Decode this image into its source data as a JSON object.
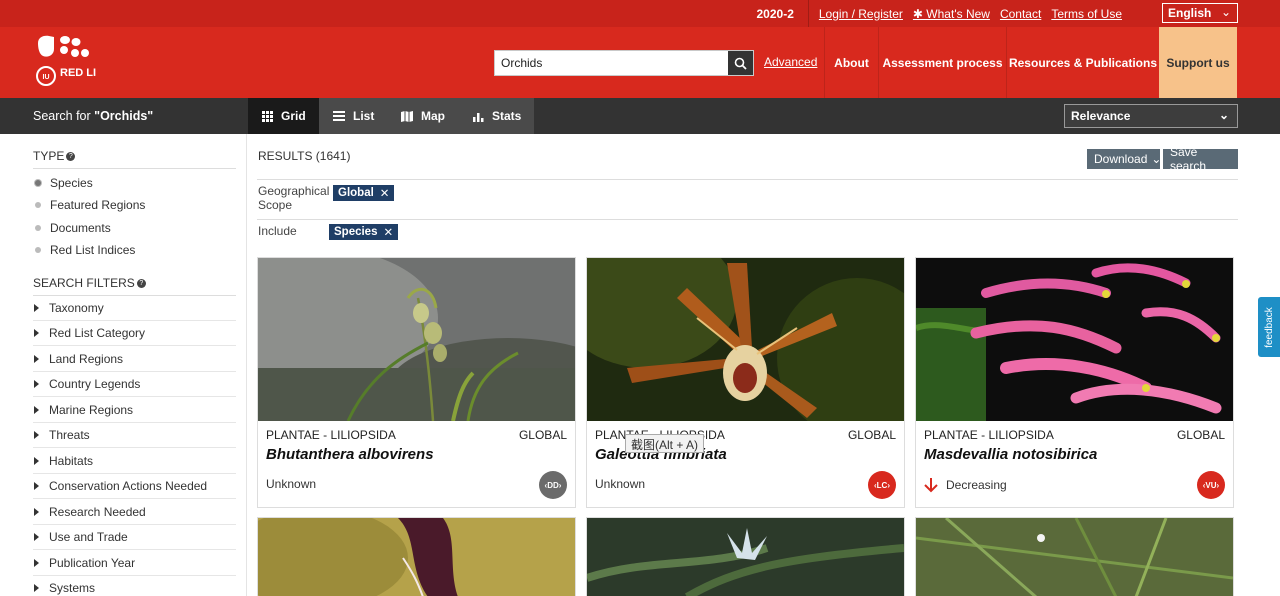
{
  "topbar": {
    "version": "2020-2",
    "links": [
      "Login / Register",
      "✱ What's New",
      "Contact",
      "Terms of Use"
    ],
    "language": "English"
  },
  "header": {
    "logo_text": "RED LIST",
    "search_value": "Orchids",
    "advanced": "Advanced",
    "nav": [
      "About",
      "Assessment process",
      "Resources & Publications",
      "Support us"
    ]
  },
  "subbar": {
    "search_prefix": "Search for ",
    "search_term": "\"Orchids\"",
    "tabs": [
      "Grid",
      "List",
      "Map",
      "Stats"
    ],
    "active_tab": "Grid",
    "sort": "Relevance"
  },
  "sidebar": {
    "type_heading": "TYPE",
    "types": [
      "Species",
      "Featured Regions",
      "Documents",
      "Red List Indices"
    ],
    "selected_type": "Species",
    "filters_heading": "SEARCH FILTERS",
    "filters": [
      "Taxonomy",
      "Red List Category",
      "Land Regions",
      "Country Legends",
      "Marine Regions",
      "Threats",
      "Habitats",
      "Conservation Actions Needed",
      "Research Needed",
      "Use and Trade",
      "Publication Year",
      "Systems"
    ]
  },
  "main": {
    "results_label": "RESULTS (1641)",
    "download": "Download",
    "save_search": "Save search",
    "geo_label": "Geographical Scope",
    "geo_chip": "Global",
    "include_label": "Include",
    "include_chip": "Species"
  },
  "cards": [
    {
      "kingdom": "PLANTAE - LILIOPSIDA",
      "scope": "GLOBAL",
      "name": "Bhutanthera albovirens",
      "trend": "Unknown",
      "category": "DD",
      "category_color": "#6b6b6b"
    },
    {
      "kingdom": "PLANTAE - LILIOPSIDA",
      "scope": "GLOBAL",
      "name": "Galeottia fimbriata",
      "trend": "Unknown",
      "category": "LC",
      "category_color": "#d8291e"
    },
    {
      "kingdom": "PLANTAE - LILIOPSIDA",
      "scope": "GLOBAL",
      "name": "Masdevallia notosibirica",
      "trend": "Decreasing",
      "category": "VU",
      "category_color": "#d8291e"
    }
  ],
  "tooltip": "截图(Alt + A)",
  "feedback": "feedback"
}
